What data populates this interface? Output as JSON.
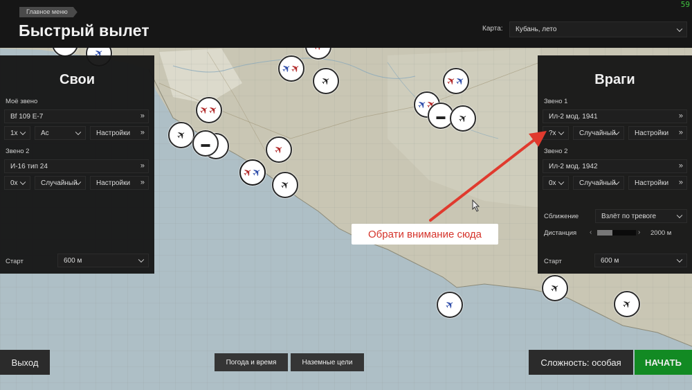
{
  "header": {
    "breadcrumb": "Главное меню",
    "title": "Быстрый вылет",
    "fps": "59",
    "map_label": "Карта:",
    "map_value": "Кубань, лето"
  },
  "left_panel": {
    "title": "Свои",
    "my_flight_label": "Моё звено",
    "my_aircraft": "Bf 109 E-7",
    "my_count": "1x",
    "my_skill": "Ас",
    "my_settings": "Настройки",
    "flight2_label": "Звено 2",
    "flight2_aircraft": "И-16 тип 24",
    "flight2_count": "0x",
    "flight2_skill": "Случайный",
    "flight2_settings": "Настройки",
    "start_label": "Старт",
    "start_value": "600 м"
  },
  "right_panel": {
    "title": "Враги",
    "flight1_label": "Звено 1",
    "flight1_aircraft": "Ил-2 мод. 1941",
    "flight1_count": "?x",
    "flight1_skill": "Случайный",
    "flight1_settings": "Настройки",
    "flight2_label": "Звено 2",
    "flight2_aircraft": "Ил-2 мод. 1942",
    "flight2_count": "0x",
    "flight2_skill": "Случайный",
    "flight2_settings": "Настройки",
    "approach_label": "Сближение",
    "approach_value": "Взлёт по тревоге",
    "distance_label": "Дистанция",
    "distance_value": "2000 м",
    "distance_fraction": 0.4,
    "start_label": "Старт",
    "start_value": "600 м"
  },
  "annotation": {
    "text": "Обрати внимание сюда",
    "color": "#e03a2e"
  },
  "footer": {
    "exit": "Выход",
    "weather": "Погода и время",
    "ground_targets": "Наземные цели",
    "difficulty": "Сложность: особая",
    "start": "НАЧАТЬ"
  },
  "icons": {
    "plane": "✈",
    "tank": "tank-icon",
    "double_arrow": "»"
  },
  "colors": {
    "accent_start": "#128a23",
    "fps": "#3fc23f",
    "annotation": "#d5332a"
  }
}
